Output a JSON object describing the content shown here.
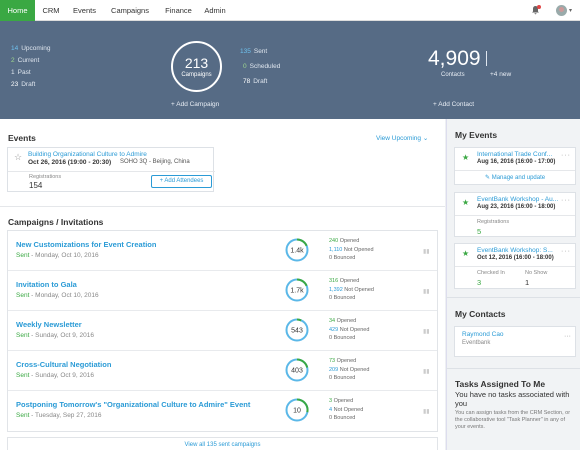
{
  "nav": {
    "tabs": [
      {
        "label": "Home",
        "active": true
      },
      {
        "label": "CRM"
      },
      {
        "label": "Events"
      },
      {
        "label": "Campaigns"
      },
      {
        "label": "Finance"
      },
      {
        "label": "Admin"
      }
    ],
    "icons": {
      "notifications": "bell-icon",
      "user": "user-avatar"
    }
  },
  "colors": {
    "accent": "#3aa843",
    "link": "#2b9bd6",
    "hero_bg": "#566b85"
  },
  "hero": {
    "left_stats": [
      {
        "value": "14",
        "label": "Upcoming"
      },
      {
        "value": "2",
        "label": "Current"
      },
      {
        "value": "1",
        "label": "Past"
      },
      {
        "value": "23",
        "label": "Draft"
      }
    ],
    "campaigns_count": "213",
    "campaigns_label": "Campaigns",
    "add_campaign": "+ Add Campaign",
    "right_stats": [
      {
        "value": "135",
        "label": "Sent"
      },
      {
        "value": "0",
        "label": "Scheduled"
      },
      {
        "value": "78",
        "label": "Draft"
      }
    ],
    "contacts_count": "4,909",
    "contacts_label": "Contacts",
    "contacts_new": "+4 new",
    "add_contact": "+ Add Contact"
  },
  "events": {
    "title": "Events",
    "view_filter": "View Upcoming",
    "item": {
      "title": "Building Organizational Culture to Admire",
      "date": "Oct 26, 2016 (19:00 - 20:30)",
      "location": "SOHO 3Q - Beijing, China",
      "registrations_label": "Registrations",
      "registrations": "154",
      "add_attendees": "+ Add Attendees"
    }
  },
  "campaigns": {
    "title": "Campaigns / Invitations",
    "items": [
      {
        "name": "New Customizations for Event Creation",
        "status": "Sent",
        "date": " - Monday, Oct 10, 2016",
        "total": "1.4k",
        "opened": "240",
        "not_opened": "1,110",
        "bounced": "0",
        "opened_label": "Opened",
        "not_opened_label": "Not Opened",
        "bounced_label": "Bounced"
      },
      {
        "name": "Invitation to Gala",
        "status": "Sent",
        "date": " - Monday, Oct 10, 2016",
        "total": "1.7k",
        "opened": "316",
        "not_opened": "1,392",
        "bounced": "0",
        "opened_label": "Opened",
        "not_opened_label": "Not Opened",
        "bounced_label": "Bounced"
      },
      {
        "name": "Weekly Newsletter",
        "status": "Sent",
        "date": " - Sunday, Oct 9, 2016",
        "total": "543",
        "opened": "34",
        "not_opened": "429",
        "bounced": "0",
        "opened_label": "Opened",
        "not_opened_label": "Not Opened",
        "bounced_label": "Bounced"
      },
      {
        "name": "Cross-Cultural Negotiation",
        "status": "Sent",
        "date": " - Sunday, Oct 9, 2016",
        "total": "403",
        "opened": "73",
        "not_opened": "209",
        "bounced": "0",
        "opened_label": "Opened",
        "not_opened_label": "Not Opened",
        "bounced_label": "Bounced"
      },
      {
        "name": "Postponing Tomorrow's \"Organizational Culture to Admire\" Event",
        "status": "Sent",
        "date": " - Tuesday, Sep 27, 2016",
        "total": "10",
        "opened": "3",
        "not_opened": "4",
        "bounced": "0",
        "opened_label": "Opened",
        "not_opened_label": "Not Opened",
        "bounced_label": "Bounced"
      }
    ],
    "view_all": "View all 135 sent campaigns"
  },
  "my_events": {
    "title": "My Events",
    "items": [
      {
        "title": "International Trade Conf...",
        "date": "Aug 16, 2016 (16:00 - 17:00)",
        "action": "Manage and update"
      },
      {
        "title": "EventBank Workshop - Au...",
        "date": "Aug 23, 2016 (16:00 - 18:00)",
        "registrations_label": "Registrations",
        "registrations": "5"
      },
      {
        "title": "EventBank Workshop: S...",
        "date": "Oct 12, 2016 (16:00 - 18:00)",
        "checked_in_label": "Checked In",
        "checked_in": "3",
        "no_show_label": "No Show",
        "no_show": "1"
      }
    ]
  },
  "my_contacts": {
    "title": "My Contacts",
    "contact": {
      "name": "Raymond Cao",
      "company": "Eventbank"
    }
  },
  "tasks": {
    "title": "Tasks Assigned To Me",
    "empty_heading": "You have no tasks associated with you",
    "empty_text": "You can assign tasks from the CRM Section, or the collaborative tool \"Task Planner\" in any of your events."
  }
}
